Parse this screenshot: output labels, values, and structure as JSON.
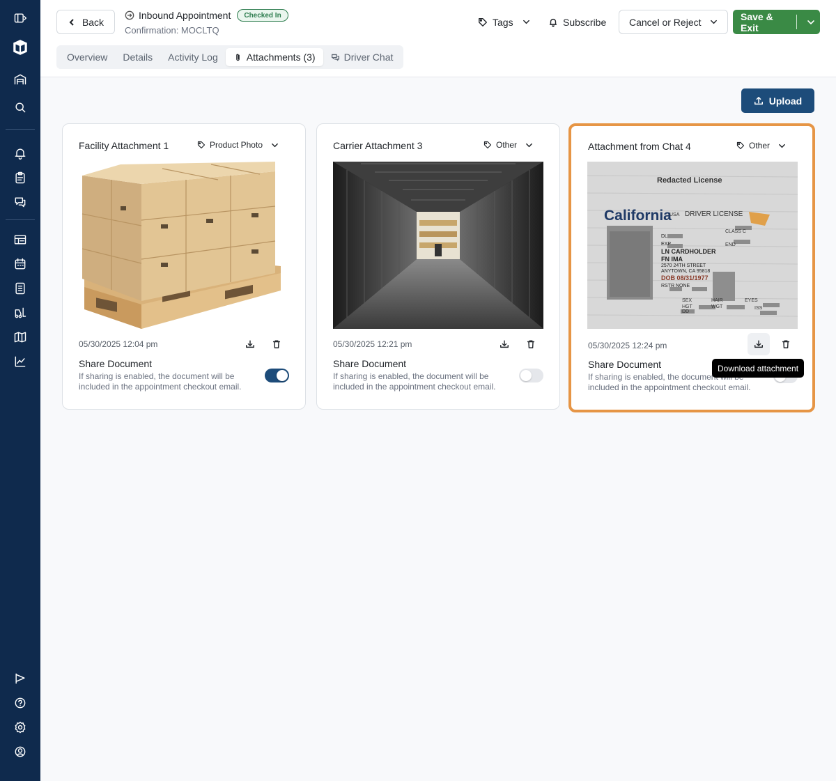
{
  "header": {
    "back_label": "Back",
    "title": "Inbound Appointment",
    "status_badge": "Checked In",
    "confirmation": "Confirmation: MOCLTQ",
    "tags_label": "Tags",
    "subscribe_label": "Subscribe",
    "cancel_label": "Cancel or Reject",
    "save_label": "Save & Exit"
  },
  "tabs": [
    {
      "label": "Overview",
      "active": false
    },
    {
      "label": "Details",
      "active": false
    },
    {
      "label": "Activity Log",
      "active": false
    },
    {
      "label": "Attachments (3)",
      "active": true
    },
    {
      "label": "Driver Chat",
      "active": false
    }
  ],
  "upload_label": "Upload",
  "cards": [
    {
      "title": "Facility Attachment 1",
      "tag": "Product Photo",
      "date": "05/30/2025 12:04 pm",
      "share_title": "Share Document",
      "share_desc": "If sharing is enabled, the document will be included in the appointment checkout email.",
      "shared": true
    },
    {
      "title": "Carrier Attachment 3",
      "tag": "Other",
      "date": "05/30/2025 12:21 pm",
      "share_title": "Share Document",
      "share_desc": "If sharing is enabled, the document will be included in the appointment checkout email.",
      "shared": false
    },
    {
      "title": "Attachment from Chat 4",
      "tag": "Other",
      "date": "05/30/2025 12:24 pm",
      "share_title": "Share Document",
      "share_desc": "If sharing is enabled, the document will be included in the appointment checkout email.",
      "shared": false,
      "license": {
        "heading": "Redacted License",
        "state": "California",
        "usa": "USA",
        "doc_type": "DRIVER LICENSE",
        "fields": [
          "DL",
          "EXP",
          "LN CARDHOLDER",
          "FN IMA",
          "2570 24TH STREET",
          "ANYTOWN, CA 95818",
          "DOB 08/31/1977",
          "RSTR NONE"
        ],
        "class": "CLASS C",
        "end": "END",
        "sex": "SEX",
        "hgt": "HGT",
        "hair": "HAIR",
        "wgt": "WGT",
        "eyes": "EYES",
        "iss": "ISS",
        "dd": "DD"
      }
    }
  ],
  "tooltip": "Download attachment",
  "colors": {
    "sidebar": "#0f2a4d",
    "primary": "#1d4c7a",
    "save": "#3a8a45",
    "highlight": "#e69545"
  }
}
